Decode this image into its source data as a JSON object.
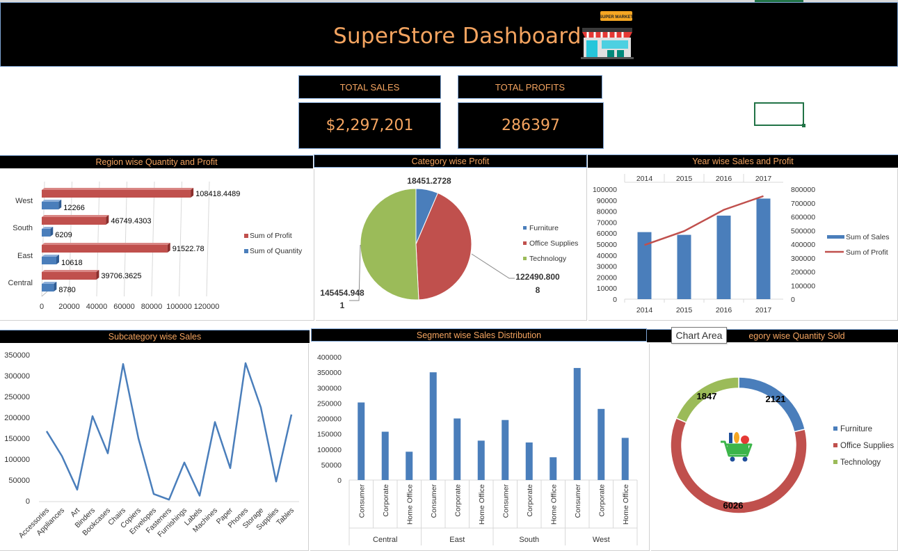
{
  "header": {
    "title": "SuperStore Dashboard",
    "icon": "supermarket-icon",
    "icon_text": "SUPER MARKET"
  },
  "kpis": {
    "total_sales_label": "TOTAL SALES",
    "total_sales_value": "$2,297,201",
    "total_profits_label": "TOTAL PROFITS",
    "total_profits_value": "286397"
  },
  "sections": {
    "region": "Region wise Quantity and Profit",
    "category": "Category wise Profit",
    "year": "Year wise Sales and Profit",
    "subcategory": "Subcategory wise Sales",
    "segment": "Segment wise Sales Distribution",
    "category_qty": "Category wise Quantity Sold",
    "category_qty_visible": "egory wise Quantity Sold"
  },
  "tooltip": "Chart Area",
  "colors": {
    "blue": "#4a7ebb",
    "red": "#c0504d",
    "green": "#9bbb59",
    "accent": "#f4a460"
  },
  "chart_data": [
    {
      "type": "bar",
      "orientation": "horizontal",
      "categories": [
        "West",
        "South",
        "East",
        "Central"
      ],
      "series": [
        {
          "name": "Sum of Profit",
          "values": [
            108418.4489,
            46749.4303,
            91522.78,
            39706.3625
          ],
          "labels": [
            "108418.4489",
            "46749.4303",
            "91522.78",
            "39706.3625"
          ]
        },
        {
          "name": "Sum of Quantity",
          "values": [
            12266,
            6209,
            10618,
            8780
          ],
          "labels": [
            "12266",
            "6209",
            "10618",
            "8780"
          ]
        }
      ],
      "xlim": [
        0,
        120000
      ],
      "xticks": [
        "0",
        "20000",
        "40000",
        "60000",
        "80000",
        "100000",
        "120000"
      ],
      "legend": "right"
    },
    {
      "type": "pie",
      "categories": [
        "Furniture",
        "Office Supplies",
        "Technology"
      ],
      "values": [
        18451.2728,
        122490.8008,
        145454.9481
      ],
      "labels": [
        [
          "18451.2728"
        ],
        [
          "122490.800",
          "8"
        ],
        [
          "145454.948",
          "1"
        ]
      ],
      "legend": "right"
    },
    {
      "type": "bar",
      "categories": [
        "2014",
        "2015",
        "2016",
        "2017"
      ],
      "series": [
        {
          "name": "Sum of Sales",
          "values": [
            61000,
            58500,
            76000,
            91500
          ],
          "axis": "left"
        },
        {
          "name": "Sum of Profit",
          "values": [
            394000,
            495000,
            650000,
            750000
          ],
          "axis": "right",
          "type": "line"
        }
      ],
      "ylim": [
        0,
        100000
      ],
      "yticks": [
        "0",
        "10000",
        "20000",
        "30000",
        "40000",
        "50000",
        "60000",
        "70000",
        "80000",
        "90000",
        "100000"
      ],
      "y2lim": [
        0,
        800000
      ],
      "y2ticks": [
        "0",
        "100000",
        "200000",
        "300000",
        "400000",
        "500000",
        "600000",
        "700000",
        "800000"
      ],
      "legend": "right"
    },
    {
      "type": "line",
      "categories": [
        "Accessories",
        "Appliances",
        "Art",
        "Binders",
        "Bookcases",
        "Chairs",
        "Copiers",
        "Envelopes",
        "Fasteners",
        "Furnishings",
        "Labels",
        "Machines",
        "Paper",
        "Phones",
        "Storage",
        "Supplies",
        "Tables"
      ],
      "series": [
        {
          "name": "Sales",
          "values": [
            167000,
            107500,
            27000,
            203000,
            114000,
            328000,
            150000,
            16500,
            3000,
            92000,
            12500,
            189000,
            78500,
            330000,
            224000,
            46500,
            207000
          ]
        }
      ],
      "ylim": [
        0,
        350000
      ],
      "yticks": [
        "0",
        "50000",
        "100000",
        "150000",
        "200000",
        "250000",
        "300000",
        "350000"
      ]
    },
    {
      "type": "bar",
      "groups": [
        "Central",
        "East",
        "South",
        "West"
      ],
      "categories": [
        "Consumer",
        "Corporate",
        "Home Office"
      ],
      "values": [
        [
          252000,
          157000,
          92000
        ],
        [
          350000,
          200000,
          128000
        ],
        [
          195000,
          122000,
          74000
        ],
        [
          364000,
          231000,
          137000
        ]
      ],
      "ylim": [
        0,
        400000
      ],
      "yticks": [
        "0",
        "50000",
        "100000",
        "150000",
        "200000",
        "250000",
        "300000",
        "350000",
        "400000"
      ]
    },
    {
      "type": "pie",
      "style": "donut",
      "categories": [
        "Furniture",
        "Office Supplies",
        "Technology"
      ],
      "values": [
        2121,
        6026,
        1847
      ],
      "labels": [
        "2121",
        "6026",
        "1847"
      ],
      "center_icon": "shopping-cart-icon",
      "legend": "right"
    }
  ]
}
